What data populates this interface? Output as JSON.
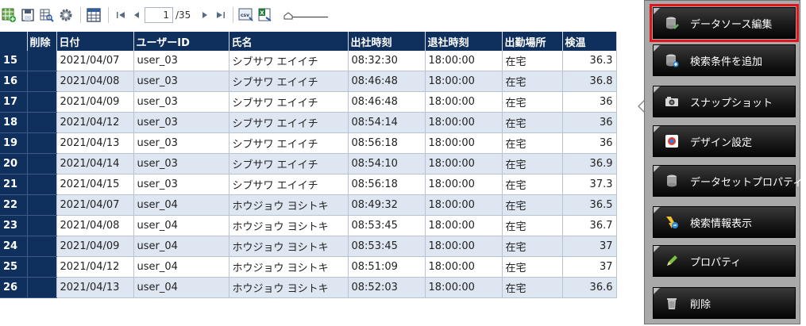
{
  "toolbar": {
    "icons": [
      "grid-add-icon",
      "save-icon",
      "search-grid-icon",
      "settings-gear-icon",
      "table-view-icon"
    ],
    "nav": [
      "first-page-icon",
      "prev-page-icon",
      "next-page-icon",
      "last-page-icon"
    ],
    "page": {
      "current": "1",
      "total": "/35"
    },
    "export": [
      "csv-export-icon",
      "excel-export-icon"
    ],
    "slider_label": "zoom-slider"
  },
  "grid": {
    "columns": [
      "",
      "削除",
      "日付",
      "ユーザーID",
      "氏名",
      "出社時刻",
      "退社時刻",
      "出勤場所",
      "検温"
    ],
    "rows": [
      {
        "n": "15",
        "date": "2021/04/07",
        "user": "user_03",
        "name": "シブサワ エイイチ",
        "in": "08:32:30",
        "out": "18:00:00",
        "place": "在宅",
        "temp": "36.3"
      },
      {
        "n": "16",
        "date": "2021/04/08",
        "user": "user_03",
        "name": "シブサワ エイイチ",
        "in": "08:46:48",
        "out": "18:00:00",
        "place": "在宅",
        "temp": "36.8"
      },
      {
        "n": "17",
        "date": "2021/04/09",
        "user": "user_03",
        "name": "シブサワ エイイチ",
        "in": "08:46:48",
        "out": "18:00:00",
        "place": "在宅",
        "temp": "36"
      },
      {
        "n": "18",
        "date": "2021/04/12",
        "user": "user_03",
        "name": "シブサワ エイイチ",
        "in": "08:54:14",
        "out": "18:00:00",
        "place": "在宅",
        "temp": "36"
      },
      {
        "n": "19",
        "date": "2021/04/13",
        "user": "user_03",
        "name": "シブサワ エイイチ",
        "in": "08:56:18",
        "out": "18:00:00",
        "place": "在宅",
        "temp": "36"
      },
      {
        "n": "20",
        "date": "2021/04/14",
        "user": "user_03",
        "name": "シブサワ エイイチ",
        "in": "08:54:10",
        "out": "18:00:00",
        "place": "在宅",
        "temp": "36.9"
      },
      {
        "n": "21",
        "date": "2021/04/15",
        "user": "user_03",
        "name": "シブサワ エイイチ",
        "in": "08:56:18",
        "out": "18:00:00",
        "place": "在宅",
        "temp": "37.3"
      },
      {
        "n": "22",
        "date": "2021/04/07",
        "user": "user_04",
        "name": "ホウジョウ ヨシトキ",
        "in": "08:49:32",
        "out": "18:00:00",
        "place": "在宅",
        "temp": "36.5"
      },
      {
        "n": "23",
        "date": "2021/04/08",
        "user": "user_04",
        "name": "ホウジョウ ヨシトキ",
        "in": "08:53:45",
        "out": "18:00:00",
        "place": "在宅",
        "temp": "36.7"
      },
      {
        "n": "24",
        "date": "2021/04/09",
        "user": "user_04",
        "name": "ホウジョウ ヨシトキ",
        "in": "08:53:45",
        "out": "18:00:00",
        "place": "在宅",
        "temp": "37"
      },
      {
        "n": "25",
        "date": "2021/04/12",
        "user": "user_04",
        "name": "ホウジョウ ヨシトキ",
        "in": "08:51:09",
        "out": "18:00:00",
        "place": "在宅",
        "temp": "37"
      },
      {
        "n": "26",
        "date": "2021/04/13",
        "user": "user_04",
        "name": "ホウジョウ ヨシトキ",
        "in": "08:52:03",
        "out": "18:00:00",
        "place": "在宅",
        "temp": "36.6"
      }
    ]
  },
  "menu": {
    "items": [
      {
        "label": "データソース編集",
        "icon": "datasource-edit-icon",
        "selected": true
      },
      {
        "label": "検索条件を追加",
        "icon": "add-search-condition-icon"
      },
      {
        "label": "スナップショット",
        "icon": "camera-icon"
      },
      {
        "label": "デザイン設定",
        "icon": "design-palette-icon"
      },
      {
        "label": "データセットプロパティ",
        "icon": "dataset-property-icon"
      },
      {
        "label": "検索情報表示",
        "icon": "search-info-icon"
      },
      {
        "label": "プロパティ",
        "icon": "pencil-icon"
      },
      {
        "label": "削除",
        "icon": "trash-icon"
      }
    ]
  },
  "colors": {
    "header_bg": "#0f2f5c",
    "row_alt": "#dde6f1",
    "highlight": "#e0161b"
  }
}
